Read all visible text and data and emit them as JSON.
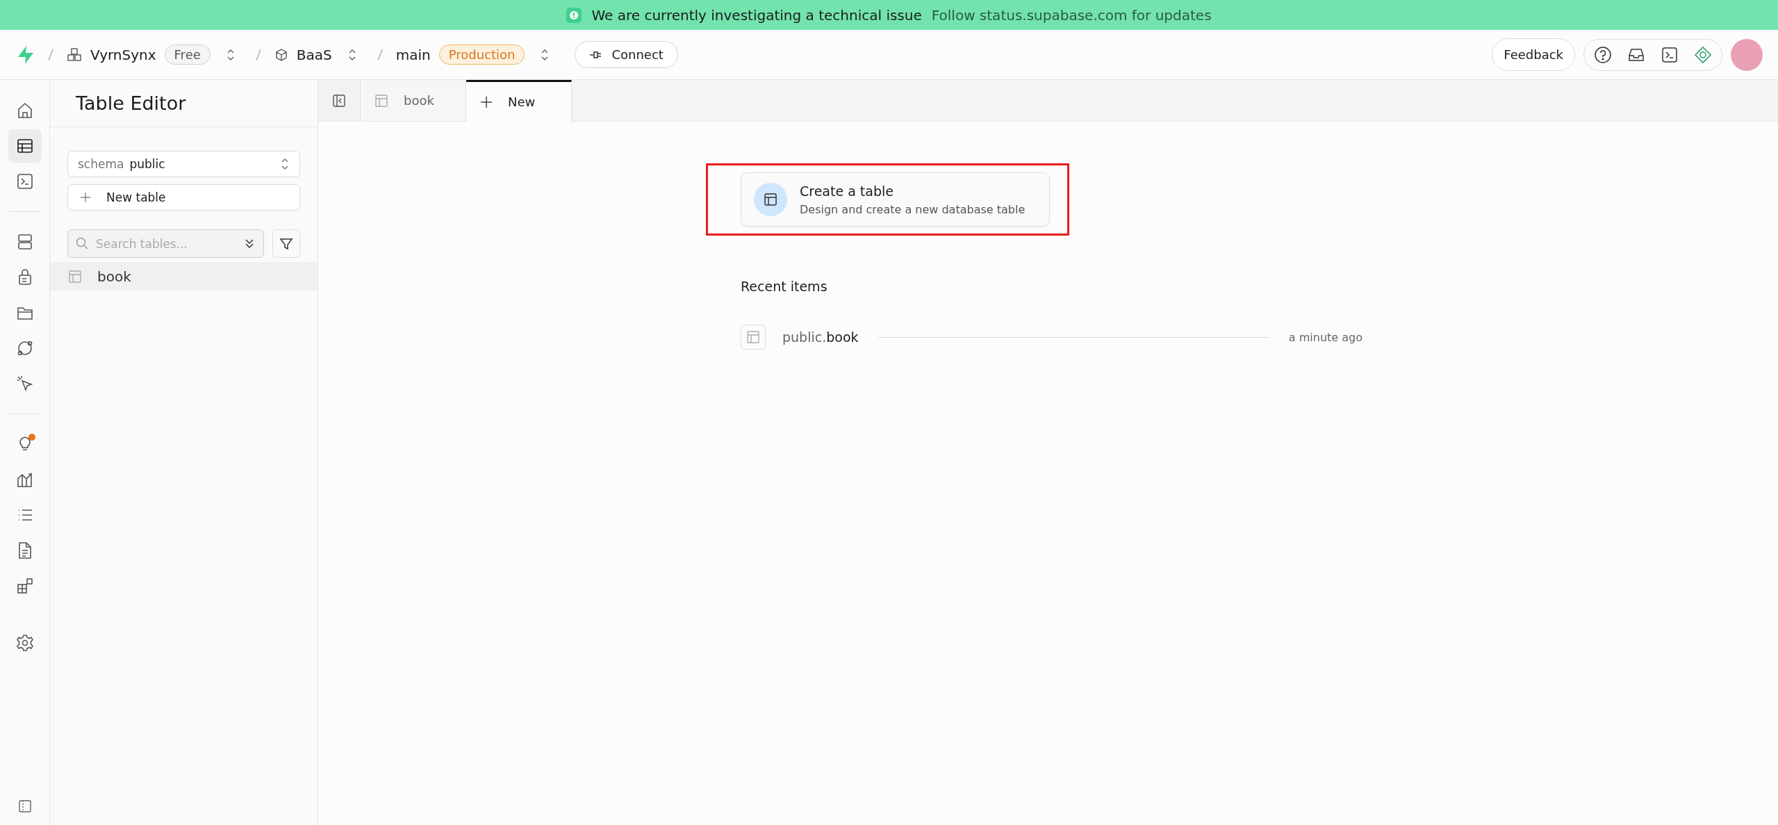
{
  "banner": {
    "message": "We are currently investigating a technical issue",
    "link": "Follow status.supabase.com for updates"
  },
  "topbar": {
    "organization": "VyrnSynx",
    "plan": "Free",
    "project": "BaaS",
    "branch": "main",
    "environment": "Production",
    "connect": "Connect",
    "feedback": "Feedback"
  },
  "nav_groups": [
    {
      "items": [
        {
          "selected": false,
          "badge": false
        },
        {
          "selected": true,
          "badge": false
        },
        {
          "selected": false,
          "badge": false
        }
      ]
    },
    {
      "items": [
        {
          "selected": false,
          "badge": false
        },
        {
          "selected": false,
          "badge": false
        },
        {
          "selected": false,
          "badge": false
        },
        {
          "selected": false,
          "badge": false
        },
        {
          "selected": false,
          "badge": false
        }
      ]
    },
    {
      "items": [
        {
          "selected": false,
          "badge": true
        },
        {
          "selected": false,
          "badge": false
        },
        {
          "selected": false,
          "badge": false
        },
        {
          "selected": false,
          "badge": false
        },
        {
          "selected": false,
          "badge": false
        }
      ]
    },
    {
      "items": [
        {
          "selected": false,
          "badge": false
        }
      ]
    }
  ],
  "sidebar": {
    "title": "Table Editor",
    "schema_label": "schema",
    "schema_value": "public",
    "new_table": "New table",
    "search": {
      "placeholder": "Search tables..."
    },
    "tables": [
      {
        "name": "book",
        "selected": true
      }
    ]
  },
  "tabs": [
    {
      "label": "book",
      "kind": "table",
      "selected": false
    },
    {
      "label": "New",
      "kind": "new",
      "selected": true
    }
  ],
  "create_card": {
    "title": "Create a table",
    "subtitle": "Design and create a new database table"
  },
  "recent": {
    "heading": "Recent items",
    "items": [
      {
        "schema": "public.",
        "name": "book",
        "time": "a minute ago"
      }
    ]
  }
}
